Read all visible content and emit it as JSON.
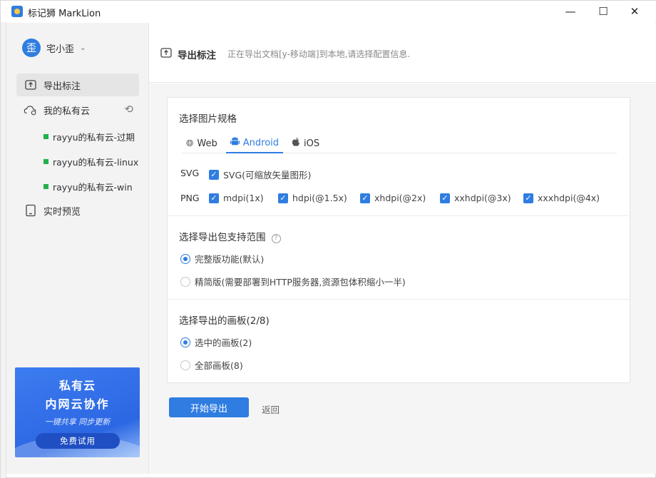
{
  "window": {
    "title": "标记狮 MarkLion",
    "controls": {
      "minimize": "—",
      "maximize": "☐",
      "close": "✕"
    }
  },
  "sidebar": {
    "user": {
      "avatar": "歪",
      "name": "宅小歪"
    },
    "items": [
      {
        "label": "导出标注",
        "icon": "export-icon",
        "active": true
      },
      {
        "label": "我的私有云",
        "icon": "cloud-icon"
      },
      {
        "label": "实时预览",
        "icon": "tablet-icon"
      }
    ],
    "clouds": [
      {
        "label": "rayyu的私有云-过期"
      },
      {
        "label": "rayyu的私有云-linux"
      },
      {
        "label": "rayyu的私有云-win"
      }
    ],
    "promo": {
      "line1": "私有云",
      "line2": "内网云协作",
      "line3": "一键共享  同步更新",
      "button": "免费试用"
    }
  },
  "header": {
    "title": "导出标注",
    "desc": "正在导出文档[y-移动端]到本地,请选择配置信息."
  },
  "spec": {
    "title": "选择图片规格",
    "tabs": [
      {
        "label": "Web",
        "icon": "globe-icon",
        "active": false
      },
      {
        "label": "Android",
        "icon": "android-icon",
        "active": true
      },
      {
        "label": "iOS",
        "icon": "apple-icon",
        "active": false
      }
    ],
    "svg_label": "SVG",
    "svg_option": "SVG(可缩放矢量图形)",
    "png_label": "PNG",
    "png_options": [
      "mdpi(1x)",
      "hdpi(@1.5x)",
      "xhdpi(@2x)",
      "xxhdpi(@3x)",
      "xxxhdpi(@4x)"
    ]
  },
  "scope": {
    "title": "选择导出包支持范围",
    "options": [
      {
        "label": "完整版功能(默认)",
        "selected": true
      },
      {
        "label": "精简版(需要部署到HTTP服务器,资源包体积缩小一半)",
        "selected": false
      }
    ]
  },
  "boards": {
    "title": "选择导出的画板(2/8)",
    "options": [
      {
        "label": "选中的画板(2)",
        "selected": true
      },
      {
        "label": "全部画板(8)",
        "selected": false
      }
    ]
  },
  "actions": {
    "start": "开始导出",
    "back": "返回"
  },
  "colors": {
    "accent": "#2f7de1",
    "cloud_status": "#21b14a"
  }
}
